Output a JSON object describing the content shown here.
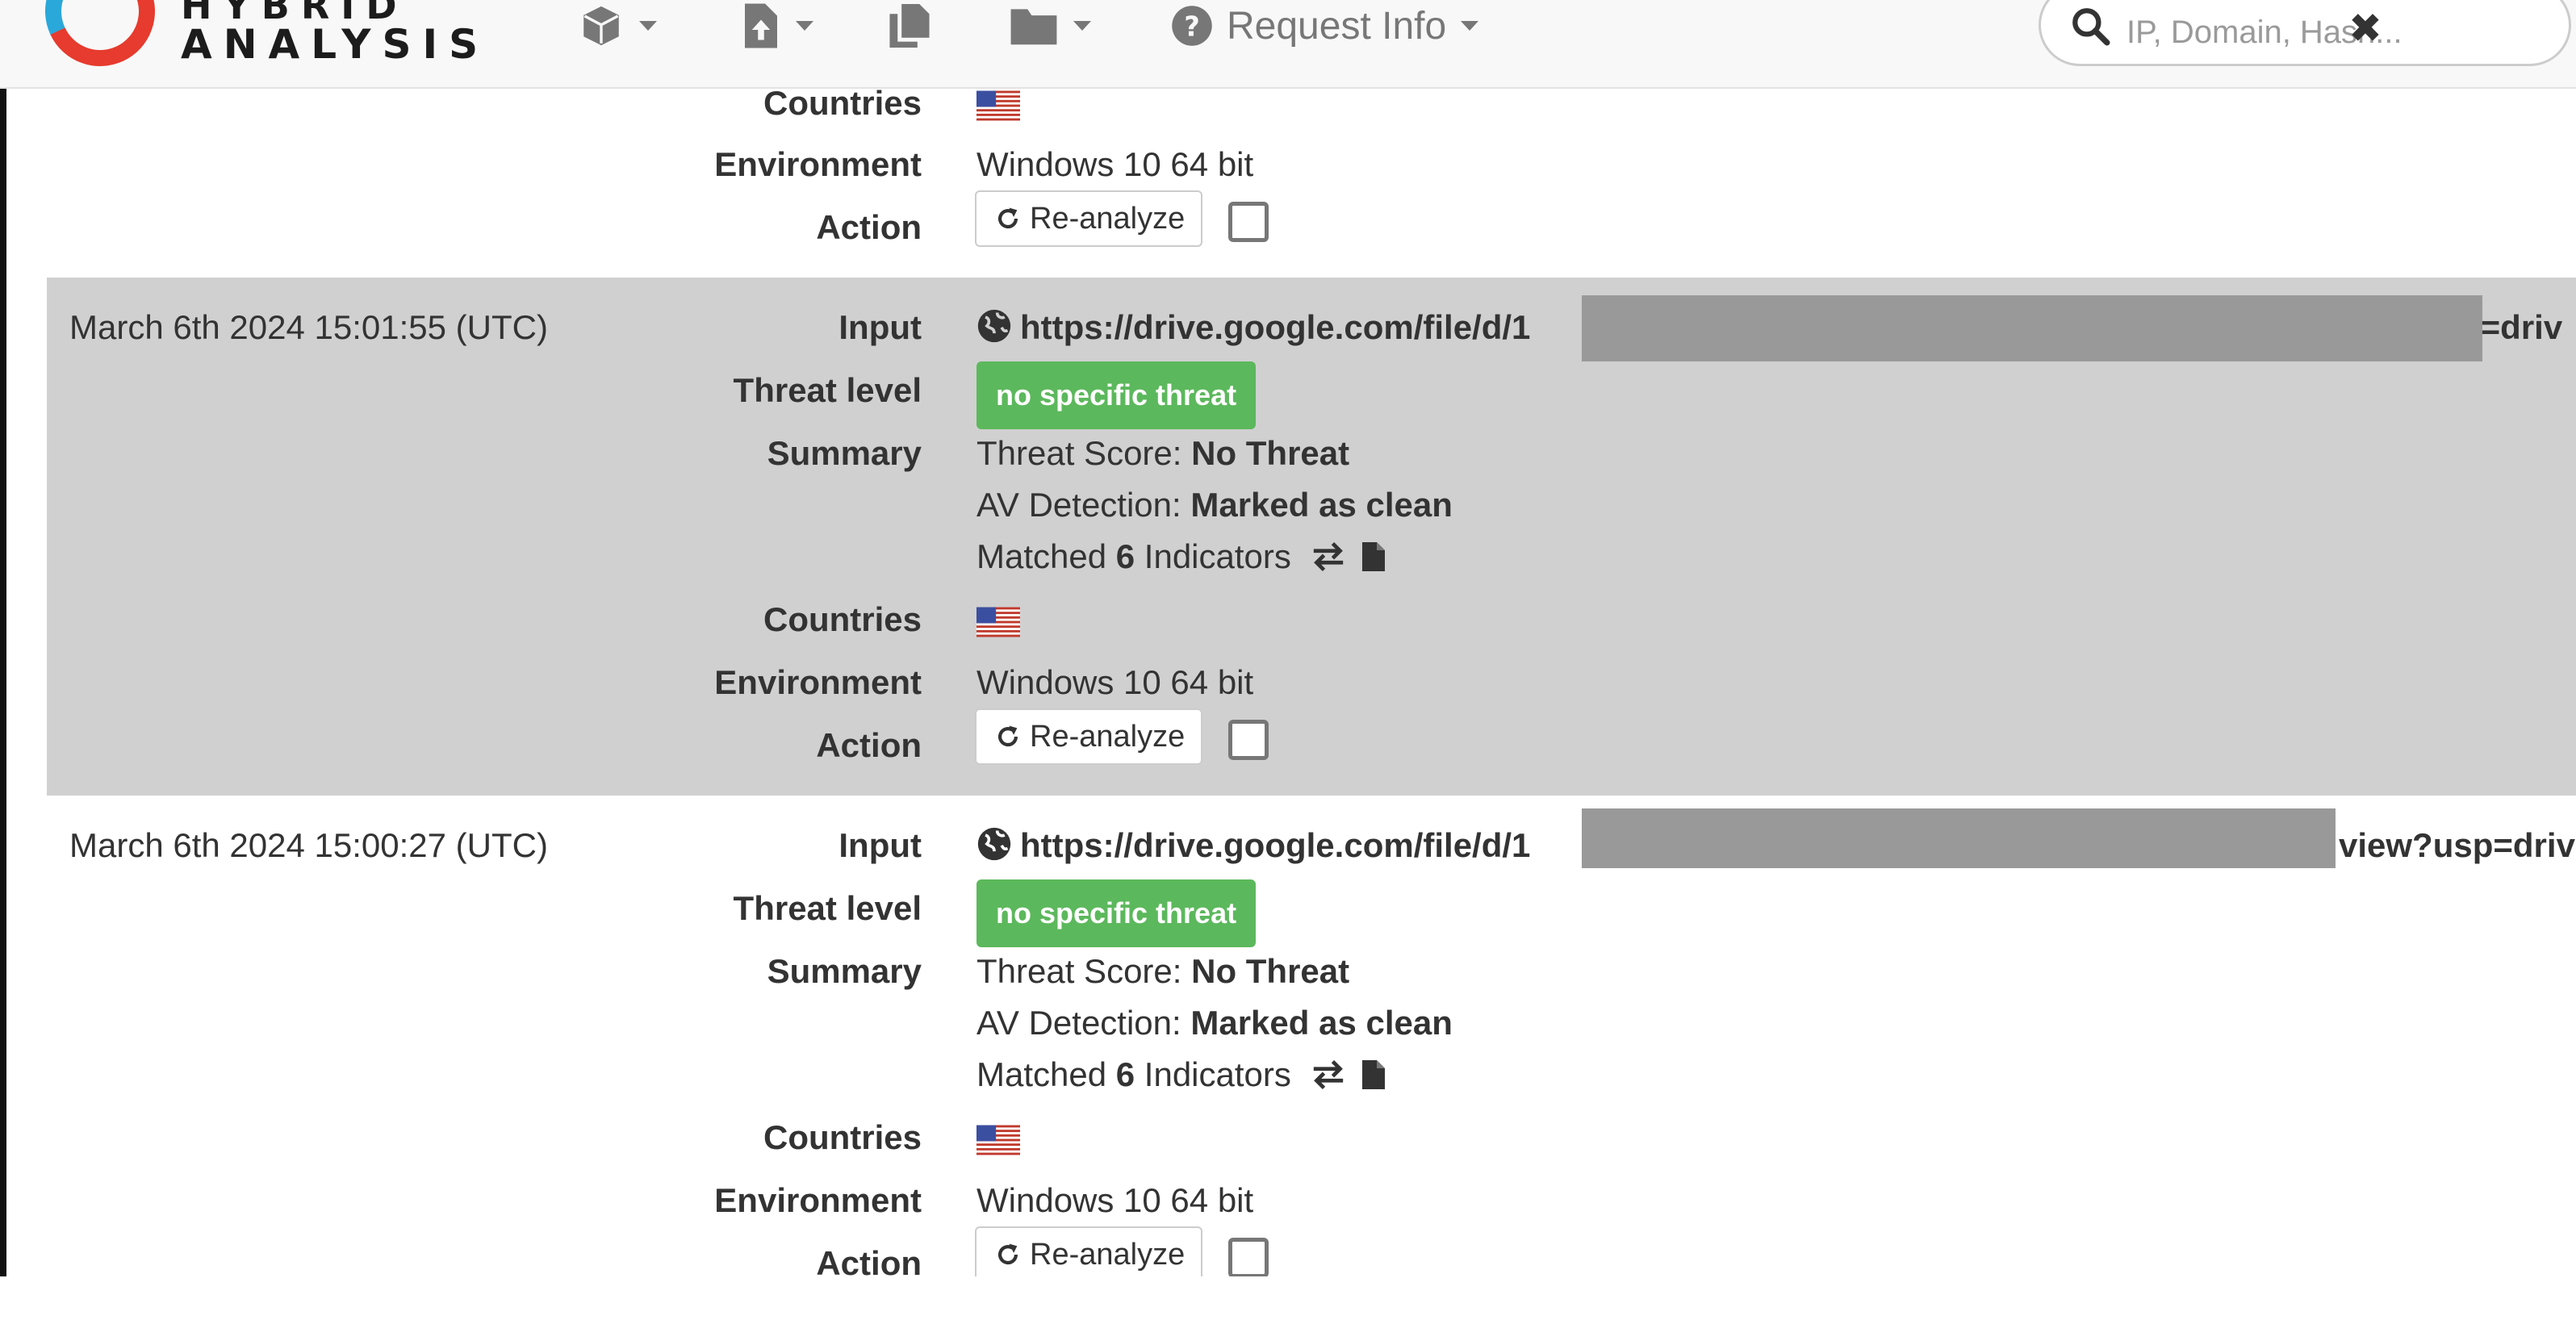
{
  "header": {
    "logo_line1": "HYBRID",
    "logo_line2": "ANALYSIS",
    "nav_request_info": "Request Info",
    "search_placeholder": "IP, Domain, Hash..."
  },
  "labels": {
    "input": "Input",
    "threat_level": "Threat level",
    "summary": "Summary",
    "countries": "Countries",
    "environment": "Environment",
    "action": "Action"
  },
  "top_partial": {
    "countries_flag": "us-flag-icon",
    "environment": "Windows 10 64 bit",
    "reanalyze_label": "Re-analyze"
  },
  "rows": [
    {
      "date": "March 6th 2024 15:01:55 (UTC)",
      "input_url_start": "https://drive.google.com/file/d/1",
      "input_url_end": "p=driv",
      "threat_level": "no specific threat",
      "threat_score_label": "Threat Score:",
      "threat_score_value": "No Threat",
      "av_label": "AV Detection:",
      "av_value": "Marked as clean",
      "matched_label": "Matched",
      "matched_count": "6",
      "indicators_label": "Indicators",
      "countries_flag": "us-flag-icon",
      "environment": "Windows 10 64 bit",
      "reanalyze_label": "Re-analyze"
    },
    {
      "date": "March 6th 2024 15:00:27 (UTC)",
      "input_url_start": "https://drive.google.com/file/d/1",
      "input_url_end": "view?usp=drive",
      "threat_level": "no specific threat",
      "threat_score_label": "Threat Score:",
      "threat_score_value": "No Threat",
      "av_label": "AV Detection:",
      "av_value": "Marked as clean",
      "matched_label": "Matched",
      "matched_count": "6",
      "indicators_label": "Indicators",
      "countries_flag": "us-flag-icon",
      "environment": "Windows 10 64 bit",
      "reanalyze_label": "Re-analyze"
    }
  ],
  "colors": {
    "threat_badge": "#5cb85c",
    "shaded_row": "#d0d0d0",
    "redaction": "#999999"
  }
}
